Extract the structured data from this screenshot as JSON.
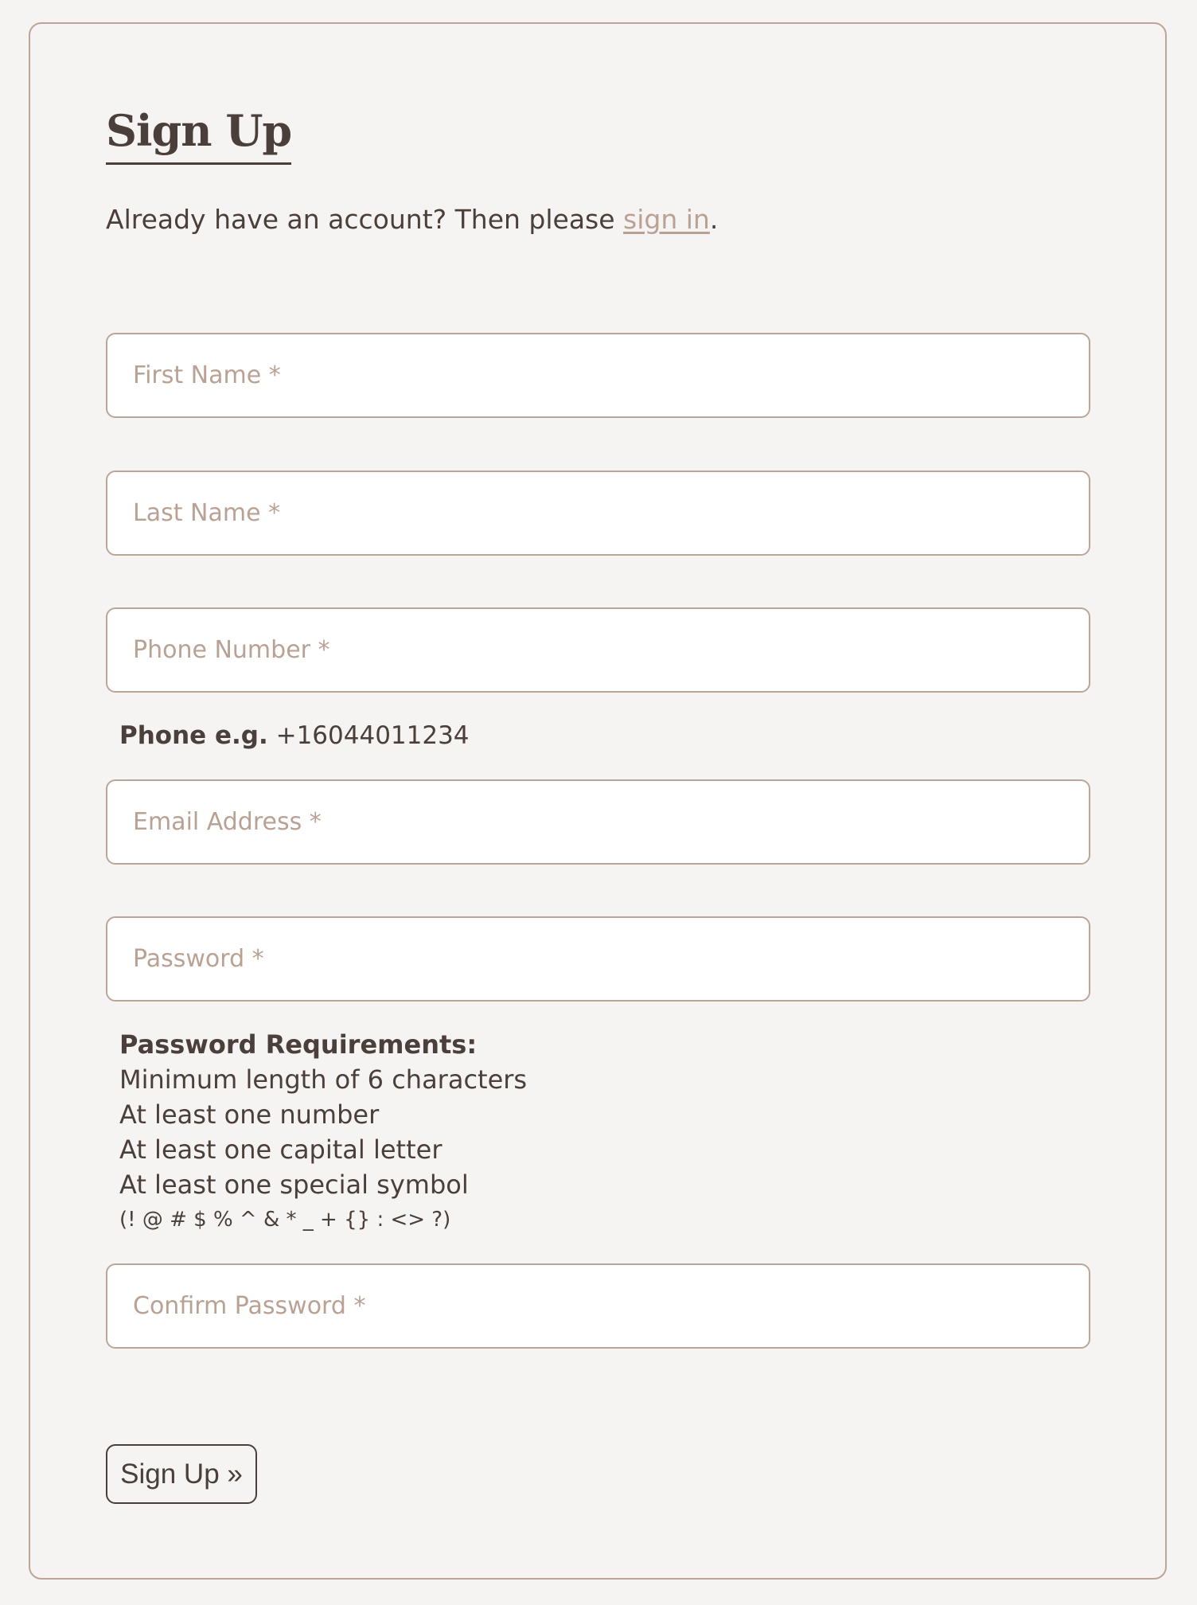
{
  "page": {
    "title": "Sign Up",
    "intro": {
      "text_before": "Already have an account? Then please ",
      "link_label": "sign in",
      "text_after": "."
    }
  },
  "form": {
    "fields": [
      {
        "name": "first-name",
        "placeholder": "First Name *",
        "value": ""
      },
      {
        "name": "last-name",
        "placeholder": "Last Name *",
        "value": ""
      },
      {
        "name": "phone-number",
        "placeholder": "Phone Number *",
        "value": ""
      },
      {
        "name": "email-address",
        "placeholder": "Email Address *",
        "value": ""
      },
      {
        "name": "password",
        "placeholder": "Password *",
        "value": ""
      },
      {
        "name": "confirm-password",
        "placeholder": "Confirm Password *",
        "value": ""
      }
    ],
    "phone_hint": {
      "label": "Phone e.g.",
      "example": " +16044011234"
    },
    "password_requirements": {
      "title": "Password Requirements:",
      "items": [
        "Minimum length of 6 characters",
        "At least one number",
        "At least one capital letter",
        "At least one special symbol"
      ],
      "symbols": "(! @ # $ % ^ & * _ + {} : <> ?)"
    },
    "submit_label": "Sign Up »"
  },
  "colors": {
    "background": "#f6f4f2",
    "text": "#4a3f3a",
    "accent": "#b9a194",
    "border": "#bba599"
  }
}
